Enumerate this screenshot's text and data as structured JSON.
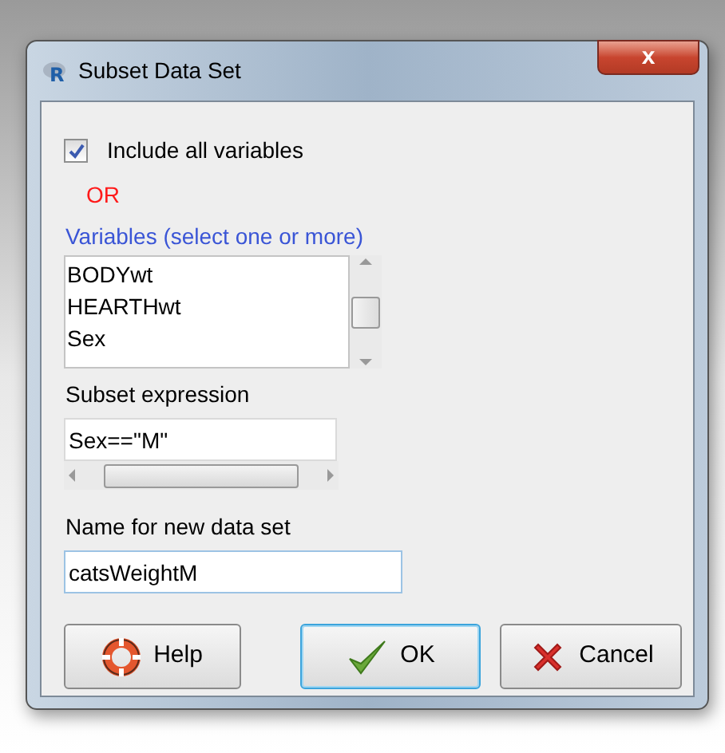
{
  "window": {
    "logo_text": "R",
    "title": "Subset Data Set",
    "close_label": "x"
  },
  "include_all": {
    "label": "Include all variables",
    "checked": true
  },
  "or_label": "OR",
  "variables": {
    "label": "Variables (select one or more)",
    "items": [
      {
        "text": "BODYwt",
        "selected": false
      },
      {
        "text": "HEARTHwt",
        "selected": false
      },
      {
        "text": "Sex",
        "selected": false
      }
    ]
  },
  "subset_expression": {
    "label": "Subset expression",
    "value": "Sex==\"M\""
  },
  "new_name": {
    "label": "Name for new data set",
    "value": "catsWeightM"
  },
  "buttons": [
    {
      "kind": "help",
      "label": "Help"
    },
    {
      "kind": "ok",
      "label": "OK"
    },
    {
      "kind": "cancel",
      "label": "Cancel"
    }
  ]
}
